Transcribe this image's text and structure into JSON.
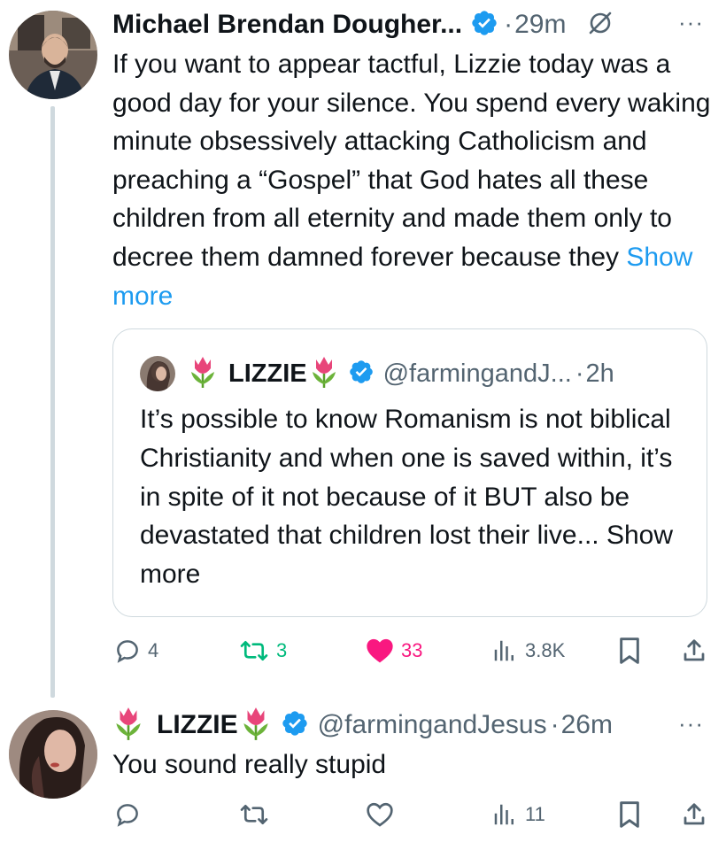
{
  "colors": {
    "text": "#0f1419",
    "muted": "#536471",
    "link": "#1d9bf0",
    "verified": "#1d9bf0",
    "retweet": "#00ba7c",
    "like": "#f91880",
    "border": "#cfd9de"
  },
  "tweet1": {
    "author_name": "Michael Brendan Dougher...",
    "separator": "·",
    "time": "29m",
    "more_label": "···",
    "body": "If you want to appear tactful, Lizzie today was a good day for your silence. You spend every waking minute obsessively attacking Catholicism and preaching a “Gospel” that God hates all these children from all eternity and made them only to decree them damned forever because they",
    "show_more": "Show more",
    "quote": {
      "author_name": "LIZZIE",
      "handle": "@farmingandJ...",
      "separator": "·",
      "time": "2h",
      "body": "It’s possible to know Romanism is not biblical Christianity and when one is saved within, it’s in spite of it not because of it BUT also be devastated that children lost their live...",
      "show_more": "Show more"
    },
    "actions": {
      "replies": "4",
      "retweets": "3",
      "likes": "33",
      "views": "3.8K"
    }
  },
  "tweet2": {
    "author_name": "LIZZIE",
    "handle": "@farmingandJesus",
    "separator": "·",
    "time": "26m",
    "more_label": "···",
    "body": "You sound really stupid",
    "actions": {
      "views": "11"
    }
  }
}
